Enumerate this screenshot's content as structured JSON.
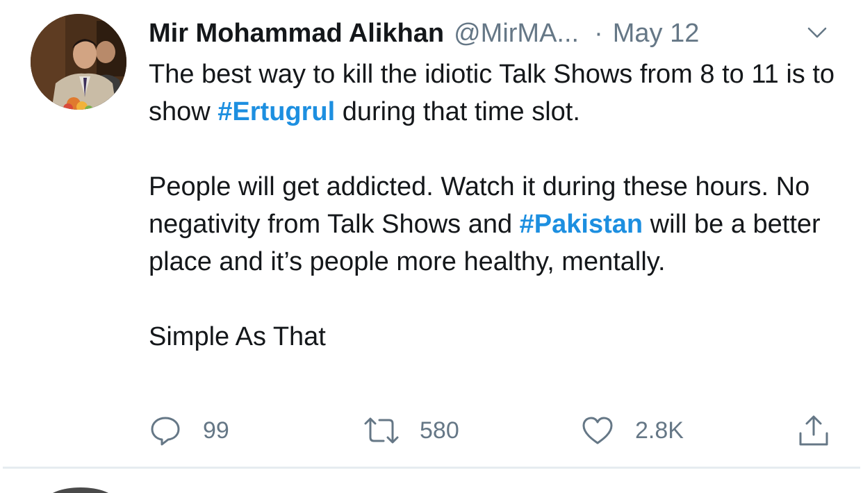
{
  "tweet": {
    "display_name": "Mir Mohammad Alikhan",
    "handle": "@MirMA...",
    "separator": "·",
    "date": "May 12",
    "body": {
      "line1_before": "The best way to kill the idiotic Talk Shows from 8 to 11 is to show ",
      "hashtag1": "#Ertugrul",
      "line1_after": " during that time slot.",
      "para2_line": "People will get addicted. Watch it during these hours. No negativity from Talk Shows and ",
      "hashtag2": "#Pakistan",
      "para2_after": " will be a better place and it’s people more healthy, mentally.",
      "para3": "Simple As That"
    },
    "actions": {
      "reply_count": "99",
      "retweet_count": "580",
      "like_count": "2.8K"
    },
    "colors": {
      "text": "#14171a",
      "secondary": "#657786",
      "hashtag": "#1d8fe0",
      "divider": "#e6ecf0"
    },
    "icons": {
      "reply": "reply-icon",
      "retweet": "retweet-icon",
      "like": "heart-icon",
      "share": "share-icon",
      "caret": "chevron-down-icon"
    }
  }
}
